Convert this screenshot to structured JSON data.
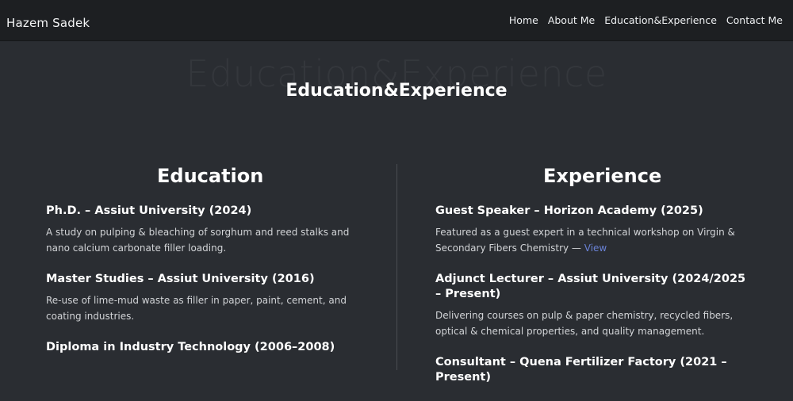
{
  "navbar": {
    "brand": "Hazem Sadek",
    "links": [
      "Home",
      "About Me",
      "Education&Experience",
      "Contact Me"
    ]
  },
  "hero": {
    "background_text": "Education&Experience",
    "title": "Education&Experience"
  },
  "education": {
    "heading": "Education",
    "entries": [
      {
        "title": "Ph.D. – Assiut University (2024)",
        "desc": "A study on pulping & bleaching of sorghum and reed stalks and nano calcium carbonate filler loading."
      },
      {
        "title": "Master Studies – Assiut University (2016)",
        "desc": "Re-use of lime-mud waste as filler in paper, paint, cement, and coating industries."
      },
      {
        "title": "Diploma in Industry Technology (2006–2008)",
        "desc": ""
      }
    ]
  },
  "experience": {
    "heading": "Experience",
    "entries": [
      {
        "title": "Guest Speaker – Horizon Academy (2025)",
        "desc": "Featured as a guest expert in a technical workshop on Virgin & Secondary Fibers Chemistry —",
        "link": "View"
      },
      {
        "title": "Adjunct Lecturer – Assiut University (2024/2025 – Present)",
        "desc": "Delivering courses on pulp & paper chemistry, recycled fibers, optical & chemical properties, and quality management."
      },
      {
        "title": "Consultant – Quena Fertilizer Factory (2021 – Present)",
        "desc": ""
      }
    ]
  },
  "colors": {
    "page_bg": "#2a2d32",
    "navbar_bg": "#1d1f22",
    "link_accent": "#6a82d6"
  }
}
